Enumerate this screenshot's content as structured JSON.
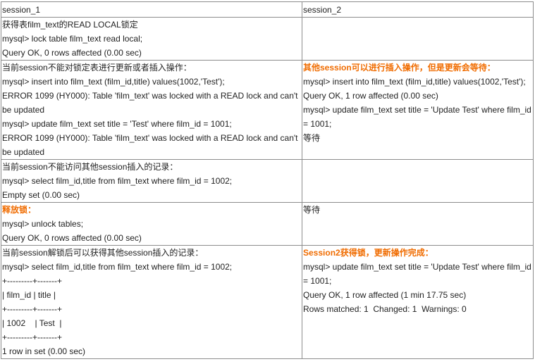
{
  "header": {
    "col1": "session_1",
    "col2": "session_2"
  },
  "rows": [
    {
      "left": [
        {
          "text": "获得表film_text的READ LOCAL锁定"
        },
        {
          "text": "mysql> lock table film_text read local;"
        },
        {
          "text": "Query OK, 0 rows affected (0.00 sec)"
        }
      ],
      "right": []
    },
    {
      "left": [
        {
          "text": "当前session不能对锁定表进行更新或者插入操作："
        },
        {
          "text": "mysql> insert into film_text (film_id,title) values(1002,'Test');"
        },
        {
          "text": "ERROR 1099 (HY000): Table 'film_text' was locked with a READ lock and can't be updated"
        },
        {
          "text": "mysql> update film_text set title = 'Test' where film_id = 1001;"
        },
        {
          "text": "ERROR 1099 (HY000): Table 'film_text' was locked with a READ lock and can't be updated"
        }
      ],
      "right": [
        {
          "text": "其他session可以进行插入操作，但是更新会等待：",
          "highlight": true
        },
        {
          "text": "mysql> insert into film_text (film_id,title) values(1002,'Test');"
        },
        {
          "text": "Query OK, 1 row affected (0.00 sec)"
        },
        {
          "text": "mysql> update film_text set title = 'Update Test' where film_id = 1001;"
        },
        {
          "text": "等待"
        }
      ]
    },
    {
      "left": [
        {
          "text": "当前session不能访问其他session插入的记录："
        },
        {
          "text": "mysql> select film_id,title from film_text where film_id = 1002;"
        },
        {
          "text": "Empty set (0.00 sec)"
        }
      ],
      "right": []
    },
    {
      "left": [
        {
          "text": "释放锁：",
          "highlight": true
        },
        {
          "text": "mysql> unlock tables;"
        },
        {
          "text": "Query OK, 0 rows affected (0.00 sec)"
        }
      ],
      "right": [
        {
          "text": "等待"
        }
      ]
    },
    {
      "left": [
        {
          "text": "当前session解锁后可以获得其他session插入的记录："
        },
        {
          "text": "mysql> select film_id,title from film_text where film_id = 1002;"
        },
        {
          "text": "+---------+-------+"
        },
        {
          "text": "| film_id | title |"
        },
        {
          "text": "+---------+-------+"
        },
        {
          "text": "| 1002    | Test  |"
        },
        {
          "text": "+---------+-------+"
        },
        {
          "text": "1 row in set (0.00 sec)"
        }
      ],
      "right": [
        {
          "text": "Session2获得锁，更新操作完成：",
          "highlight": true
        },
        {
          "text": "mysql> update film_text set title = 'Update Test' where film_id = 1001;"
        },
        {
          "text": "Query OK, 1 row affected (1 min 17.75 sec)"
        },
        {
          "text": "Rows matched: 1  Changed: 1  Warnings: 0"
        }
      ]
    }
  ],
  "colors": {
    "highlight": "#f06c00",
    "border": "#8c8c8c",
    "text": "#222222"
  }
}
